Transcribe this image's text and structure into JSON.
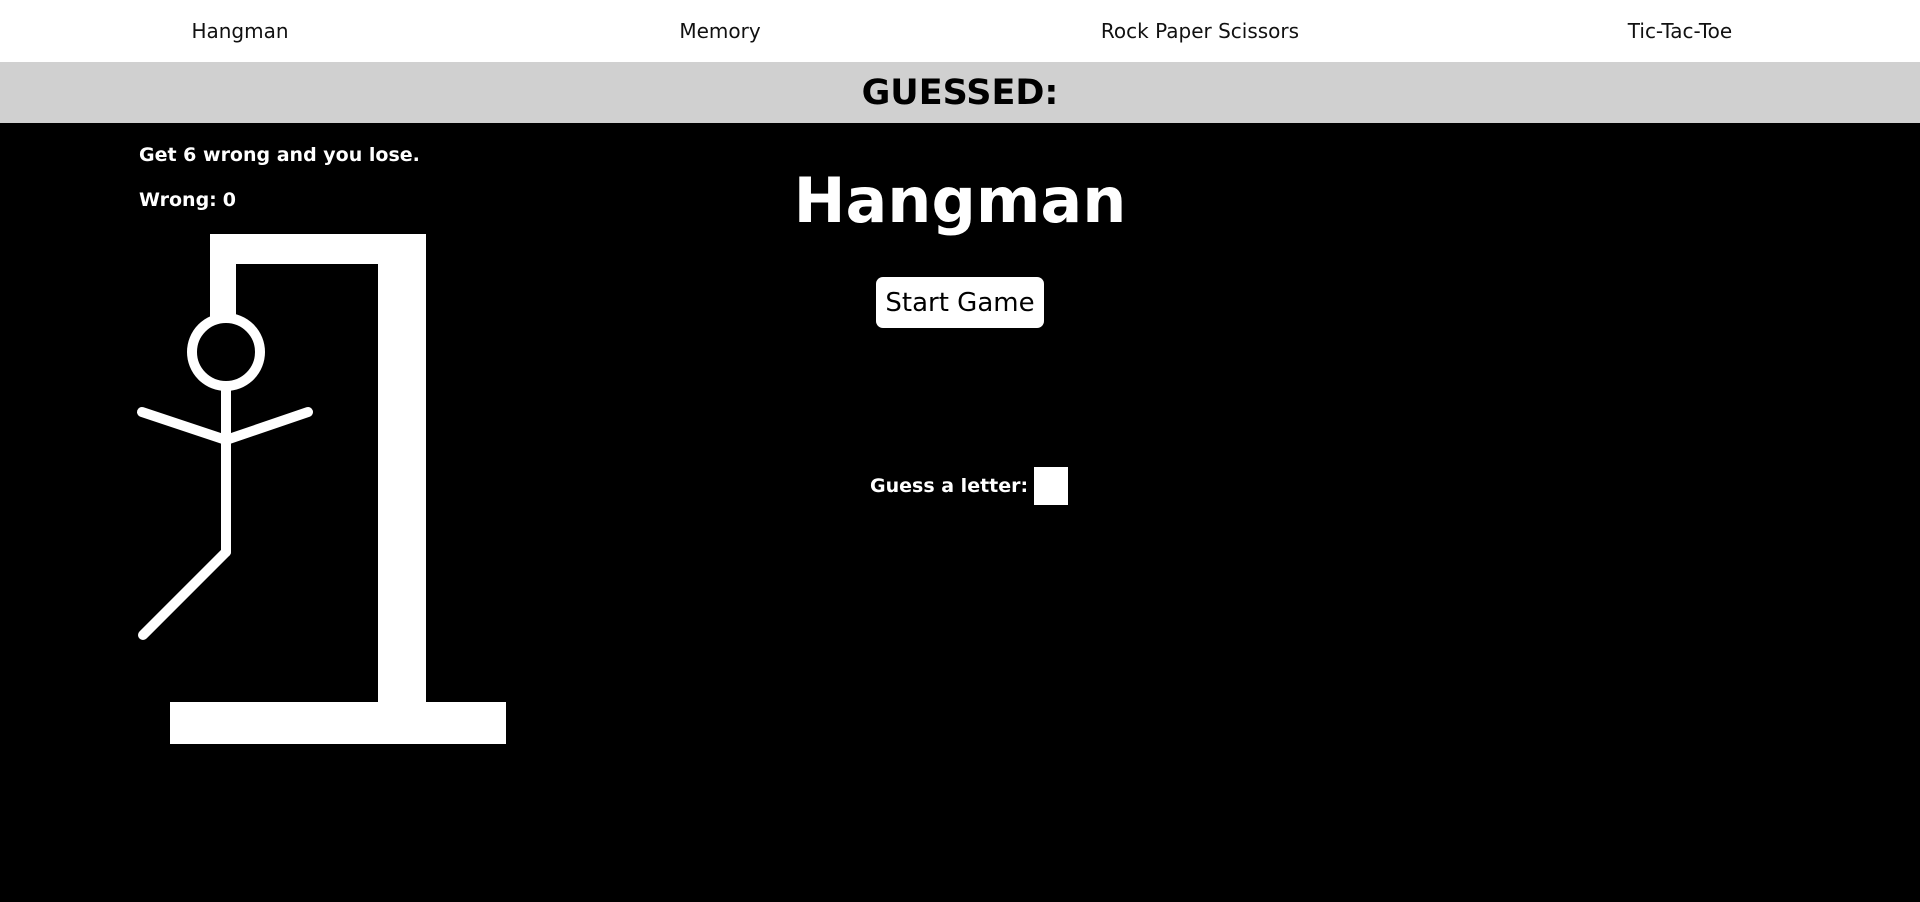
{
  "nav": {
    "items": [
      {
        "label": "Hangman"
      },
      {
        "label": "Memory"
      },
      {
        "label": "Rock Paper Scissors"
      },
      {
        "label": "Tic-Tac-Toe"
      }
    ]
  },
  "guessed": {
    "label": "GUESSED:"
  },
  "game": {
    "rules": "Get 6 wrong and you lose.",
    "wrong_label": "Wrong:",
    "wrong_count": "0",
    "max_wrong": 6,
    "title": "Hangman",
    "start_button": "Start Game",
    "guess_label": "Guess a letter:",
    "guess_value": ""
  },
  "drawing": {
    "parts_shown": [
      "head",
      "body",
      "left-arm",
      "right-arm",
      "left-leg"
    ]
  },
  "colors": {
    "background": "#000000",
    "nav_background": "#ffffff",
    "guessed_bar": "#d0d0d0",
    "foreground": "#ffffff"
  }
}
